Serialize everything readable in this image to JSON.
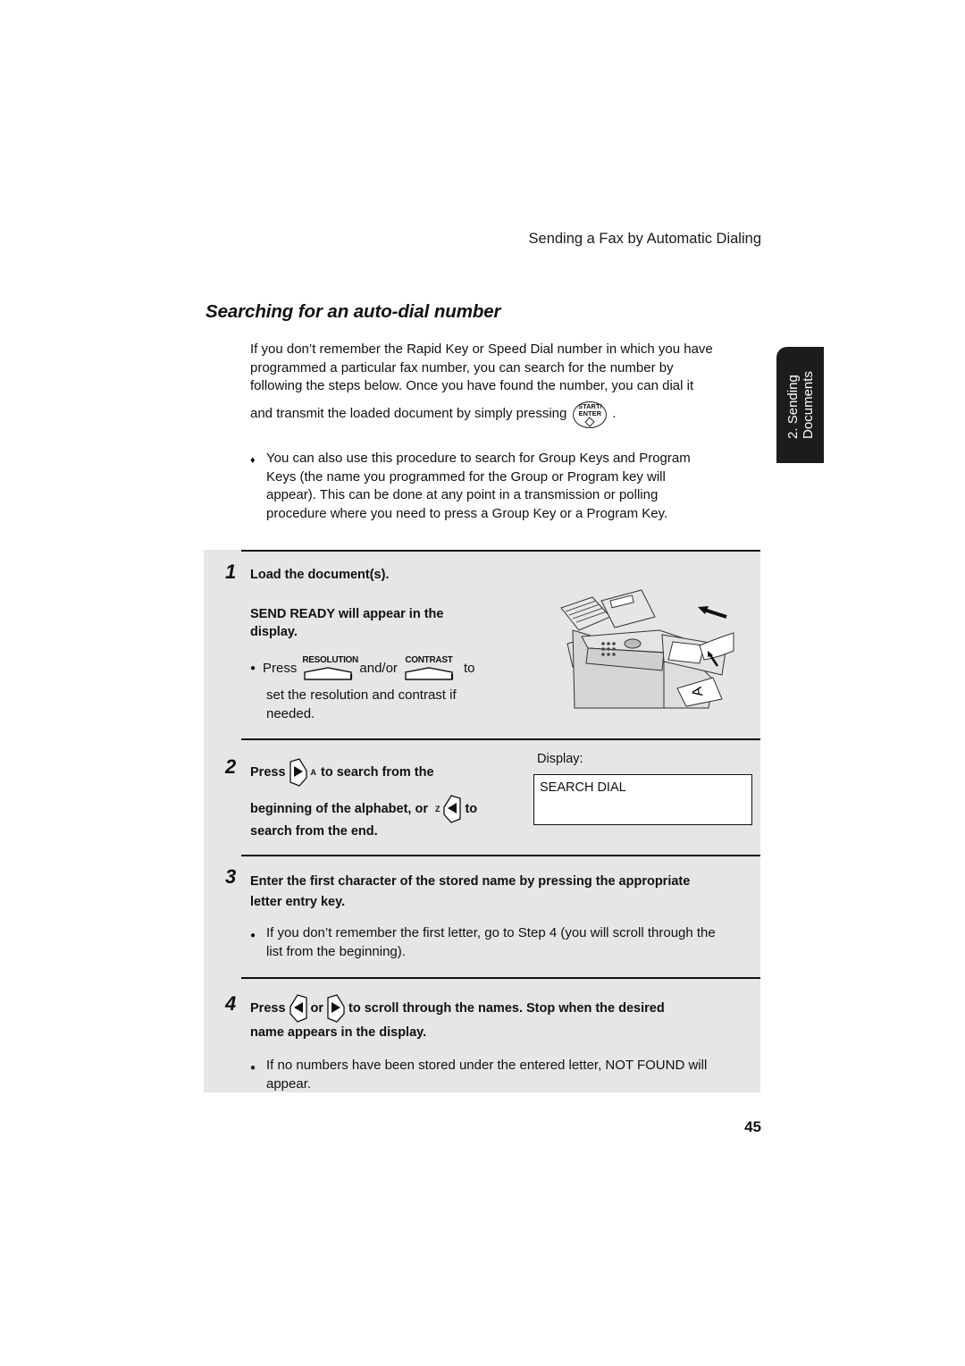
{
  "header": {
    "running_head": "Sending a Fax by Automatic Dialing",
    "section_title": "Searching for an auto-dial number"
  },
  "side_tab": {
    "line1": "2. Sending",
    "line2": "Documents"
  },
  "intro": {
    "lines": [
      "If you don’t remember the Rapid Key or Speed Dial number in which you have",
      "programmed a particular fax number, you can search for the number by",
      "following the steps below. Once you have found the number, you can dial it"
    ],
    "last_line_text": "and transmit the loaded document by simply pressing",
    "last_line_end": ".",
    "start_key": {
      "line1": "START/",
      "line2": "ENTER",
      "icon": "start-diamond-icon"
    }
  },
  "note": {
    "bullet": "♦",
    "lines": [
      "You can also use this procedure to search for Group Keys and Program",
      "Keys (the name you programmed for the Group or Program key will",
      "appear). This can be done at any point in a transmission or polling",
      "procedure where you need to press a Group Key or a Program Key."
    ]
  },
  "steps": [
    {
      "number": "1",
      "title": "Load the document(s).",
      "subtitle_lines": [
        "SEND READY will appear in the",
        "display."
      ],
      "bullet_press": "Press",
      "bullet_andor": "and/or",
      "bullet_to": "to",
      "key1": "RESOLUTION",
      "key2": "CONTRAST",
      "bullet_rest": [
        "set the resolution and contrast if",
        "needed."
      ],
      "illustration": "fax-machine-loading-document-illustration",
      "illustration_letter": "A"
    },
    {
      "number": "2",
      "press": "Press",
      "key_a_label": "A",
      "line1_rest": "to search from the",
      "line2_start": "beginning of the alphabet, or",
      "key_z_label": "Z",
      "line2_end": "to",
      "line3": "search from the end.",
      "display_label": "Display:",
      "display_text": "SEARCH DIAL"
    },
    {
      "number": "3",
      "title_lines": [
        "Enter the first character of the stored name by pressing the appropriate",
        "letter entry key."
      ],
      "bullet_lines": [
        "If you don’t remember the first letter, go to Step 4 (you will scroll through the",
        "list from the beginning)."
      ]
    },
    {
      "number": "4",
      "press": "Press",
      "or": "or",
      "line1_rest": "to scroll through the names. Stop when the desired",
      "line2": "name appears in the display.",
      "bullet_lines": [
        "If no numbers have been stored under the entered letter, NOT FOUND will",
        "appear."
      ]
    }
  ],
  "footer": {
    "page_number": "45"
  }
}
